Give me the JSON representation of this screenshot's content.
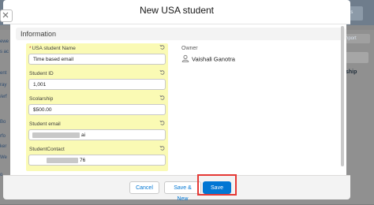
{
  "modal": {
    "title": "New USA student",
    "section_title": "Information"
  },
  "fields": [
    {
      "label": "USA student Name",
      "required": true,
      "value": "Time based email"
    },
    {
      "label": "Student ID",
      "required": false,
      "value": "1,001"
    },
    {
      "label": "Scolarship",
      "required": false,
      "value": "$500.00"
    },
    {
      "label": "Student email",
      "required": false,
      "value": "ai"
    },
    {
      "label": "StudentContact",
      "required": false,
      "value": "76"
    }
  ],
  "owner": {
    "label": "Owner",
    "name": "Vaishali Ganotra"
  },
  "footer": {
    "cancel_label": "Cancel",
    "save_new_label": "Save & New",
    "save_label": "Save"
  },
  "background": {
    "top_right_tab": "ents",
    "right_button": "nport",
    "right_word": "ship",
    "left_words": [
      "ewe",
      "s ac",
      "ent",
      "ray",
      "/erf",
      "Bo",
      "rfo",
      "ker",
      "We",
      "o"
    ]
  },
  "colors": {
    "highlight_field": "#fafab4",
    "brand_button": "#0176d3",
    "callout_border": "#e53935"
  }
}
